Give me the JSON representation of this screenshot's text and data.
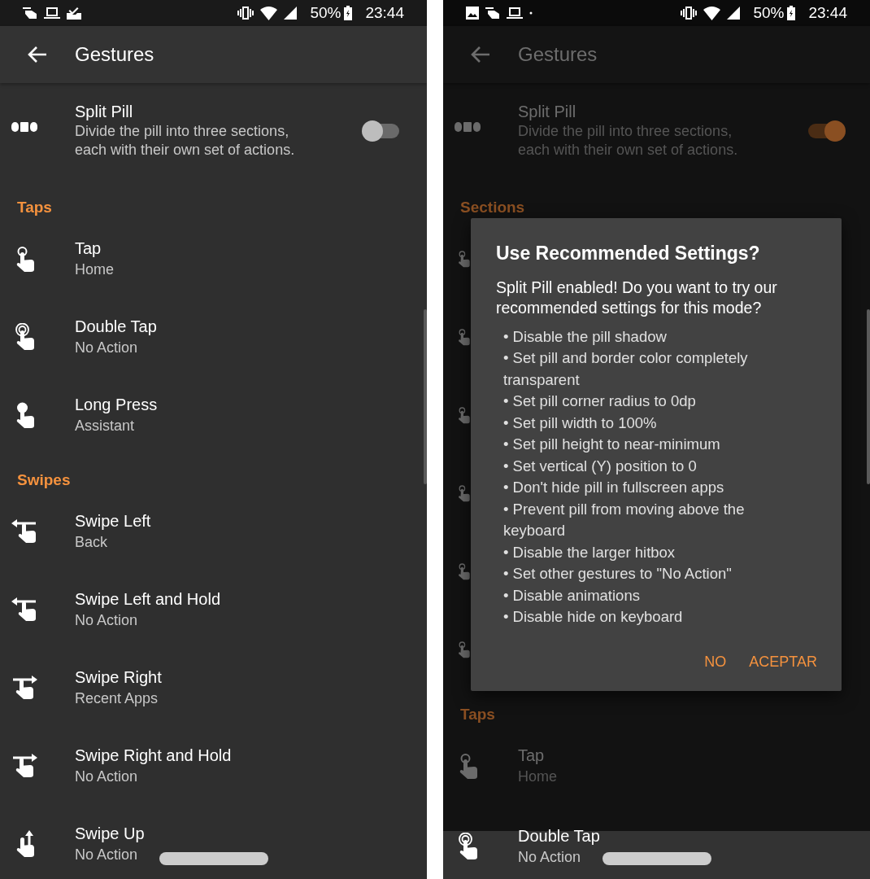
{
  "screens": [
    {
      "status_bar": {
        "notification_icons": [
          {
            "kind": "gesture"
          },
          {
            "kind": "laptop"
          },
          {
            "kind": "tray"
          }
        ],
        "battery": "50%",
        "time": "23:44"
      },
      "app_bar": {
        "title": "Gestures"
      },
      "split_pill": {
        "title": "Split Pill",
        "summary": "Divide the pill into three sections, each with their own set of actions.",
        "on": false
      },
      "sections": [
        {
          "header": "Taps",
          "items": [
            {
              "kind": "tap",
              "title": "Tap",
              "summary": "Home"
            },
            {
              "kind": "double_tap",
              "title": "Double Tap",
              "summary": "No Action"
            },
            {
              "kind": "long_press",
              "title": "Long Press",
              "summary": "Assistant"
            }
          ]
        },
        {
          "header": "Swipes",
          "items": [
            {
              "kind": "swipe_left",
              "title": "Swipe Left",
              "summary": "Back"
            },
            {
              "kind": "swipe_left",
              "title": "Swipe Left and Hold",
              "summary": "No Action"
            },
            {
              "kind": "swipe_right",
              "title": "Swipe Right",
              "summary": "Recent Apps"
            },
            {
              "kind": "swipe_right",
              "title": "Swipe Right and Hold",
              "summary": "No Action"
            },
            {
              "kind": "swipe_up",
              "title": "Swipe Up",
              "summary": "No Action"
            }
          ]
        }
      ]
    },
    {
      "status_bar": {
        "notification_icons": [
          {
            "kind": "image"
          },
          {
            "kind": "gesture"
          },
          {
            "kind": "laptop"
          },
          {
            "kind": "dot"
          }
        ],
        "battery": "50%",
        "time": "23:44"
      },
      "app_bar": {
        "title": "Gestures"
      },
      "split_pill": {
        "title": "Split Pill",
        "summary": "Divide the pill into three sections, each with their own set of actions.",
        "on": true
      },
      "sections": [
        {
          "header": "Sections",
          "items": [
            {
              "kind": "tap"
            },
            {
              "kind": "tap"
            },
            {
              "kind": "tap"
            },
            {
              "kind": "tap"
            },
            {
              "kind": "tap"
            },
            {
              "kind": "tap"
            }
          ]
        },
        {
          "header": "Taps",
          "items": [
            {
              "kind": "tap",
              "title": "Tap",
              "summary": "Home"
            }
          ]
        }
      ],
      "bottom_row": {
        "kind": "double_tap",
        "title": "Double Tap",
        "summary": "No Action"
      },
      "dialog": {
        "title": "Use Recommended Settings?",
        "message": "Split Pill enabled! Do you want to try our recommended settings for this mode?",
        "bullets": [
          "• Disable the pill shadow",
          "• Set pill and border color completely transparent",
          "• Set pill corner radius to 0dp",
          "• Set pill width to 100%",
          "• Set pill height to near-minimum",
          "• Set vertical (Y) position to 0",
          "• Don't hide pill in fullscreen apps",
          "• Prevent pill from moving above the keyboard",
          "• Disable the larger hitbox",
          "• Set other gestures to \"No Action\"",
          "• Disable animations",
          "• Disable hide on keyboard"
        ],
        "buttons": [
          {
            "label": "NO"
          },
          {
            "label": "ACEPTAR"
          }
        ]
      }
    }
  ]
}
